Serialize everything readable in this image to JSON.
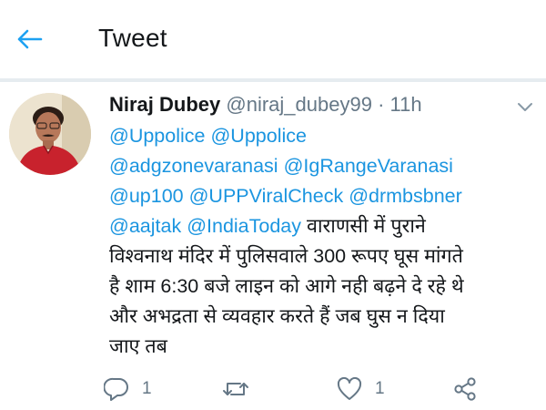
{
  "header": {
    "title": "Tweet",
    "back_icon": "back-arrow-icon"
  },
  "tweet": {
    "author": {
      "name": "Niraj Dubey",
      "handle": "@niraj_dubey99",
      "separator": "·",
      "time": "11h"
    },
    "lines": [
      {
        "parts": [
          {
            "text": "@Uppolice",
            "mention": true
          },
          {
            "text": " ",
            "mention": false
          },
          {
            "text": "@Uppolice",
            "mention": true
          }
        ]
      },
      {
        "parts": [
          {
            "text": "@adgzonevaranasi",
            "mention": true
          },
          {
            "text": " ",
            "mention": false
          },
          {
            "text": "@IgRangeVaranasi",
            "mention": true
          }
        ]
      },
      {
        "parts": [
          {
            "text": "@up100",
            "mention": true
          },
          {
            "text": " ",
            "mention": false
          },
          {
            "text": "@UPPViralCheck",
            "mention": true
          },
          {
            "text": " ",
            "mention": false
          },
          {
            "text": "@drmbsbner",
            "mention": true
          }
        ]
      },
      {
        "parts": [
          {
            "text": "@aajtak",
            "mention": true
          },
          {
            "text": " ",
            "mention": false
          },
          {
            "text": "@IndiaToday",
            "mention": true
          },
          {
            "text": " वाराणसी में पुराने",
            "mention": false
          }
        ]
      },
      {
        "parts": [
          {
            "text": "विश्वनाथ मंदिर में पुलिसवाले 300 रूपए घूस मांगते",
            "mention": false
          }
        ]
      },
      {
        "parts": [
          {
            "text": "है शाम 6:30 बजे लाइन को आगे नही बढ़ने दे रहे थे",
            "mention": false
          }
        ]
      },
      {
        "parts": [
          {
            "text": "और अभद्रता से व्यवहार करते हैं जब घुस न दिया",
            "mention": false
          }
        ]
      },
      {
        "parts": [
          {
            "text": "जाए तब",
            "mention": false
          }
        ]
      }
    ],
    "actions": {
      "reply": {
        "icon": "reply-icon",
        "count": "1"
      },
      "retweet": {
        "icon": "retweet-icon",
        "count": ""
      },
      "like": {
        "icon": "heart-icon",
        "count": "1"
      },
      "share": {
        "icon": "share-icon",
        "count": ""
      }
    }
  },
  "colors": {
    "accent": "#1b95e0",
    "text": "#14171a",
    "muted": "#657786",
    "divider": "#e6ecf0"
  }
}
